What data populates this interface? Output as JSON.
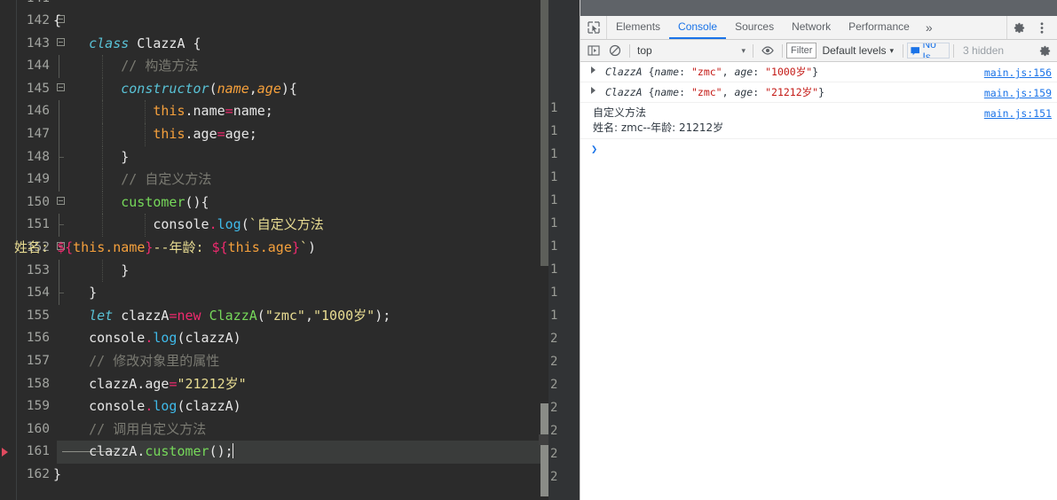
{
  "editor": {
    "first_visible_line": 141,
    "current_line": 161,
    "lines": [
      {
        "num": "141",
        "text": "",
        "clipped": true
      },
      {
        "num": "142",
        "text": "{"
      },
      {
        "num": "143",
        "text": "class ClazzA {"
      },
      {
        "num": "144",
        "text": "// 构造方法"
      },
      {
        "num": "145",
        "text": "constructor(name,age){"
      },
      {
        "num": "146",
        "text": "this.name=name;"
      },
      {
        "num": "147",
        "text": "this.age=age;"
      },
      {
        "num": "148",
        "text": "}"
      },
      {
        "num": "149",
        "text": "// 自定义方法"
      },
      {
        "num": "150",
        "text": "customer(){"
      },
      {
        "num": "151",
        "text": "console.log(`自定义方法"
      },
      {
        "num": "152",
        "text": "姓名: ${this.name}--年龄: ${this.age}`)"
      },
      {
        "num": "153",
        "text": "}"
      },
      {
        "num": "154",
        "text": "}"
      },
      {
        "num": "155",
        "text": "let clazzA=new ClazzA(\"zmc\",\"1000岁\");"
      },
      {
        "num": "156",
        "text": "console.log(clazzA)"
      },
      {
        "num": "157",
        "text": "// 修改对象里的属性"
      },
      {
        "num": "158",
        "text": "clazzA.age=\"21212岁\""
      },
      {
        "num": "159",
        "text": "console.log(clazzA)"
      },
      {
        "num": "160",
        "text": "// 调用自定义方法"
      },
      {
        "num": "161",
        "text": "clazzA.customer();"
      },
      {
        "num": "162",
        "text": "}"
      }
    ],
    "mini_gutter_numbers": [
      "1",
      "1",
      "1",
      "1",
      "1",
      "1",
      "1",
      "1",
      "1",
      "1",
      "2",
      "2",
      "2",
      "2",
      "2",
      "2",
      "2"
    ],
    "colors": {
      "background": "#2b2b2b",
      "keyword": "#59c2d6",
      "parameter": "#f5a03c",
      "operator": "#ef2a6e",
      "function": "#76d85a",
      "method": "#3fb9e8",
      "comment": "#7a7a72",
      "string": "#e8dc92",
      "plain": "#e6e6e6",
      "line_number": "#a2a4a0",
      "current_line_highlight": "#3a3c3b",
      "breakpoint_arrow": "#e04a5f"
    }
  },
  "devtools": {
    "tabs": [
      {
        "label": "Elements",
        "active": false
      },
      {
        "label": "Console",
        "active": true
      },
      {
        "label": "Sources",
        "active": false
      },
      {
        "label": "Network",
        "active": false
      },
      {
        "label": "Performance",
        "active": false
      }
    ],
    "more_tabs_label": "»",
    "inspect_icon": "inspect-element-icon",
    "device_toolbar_icon": "device-toolbar-icon",
    "settings_icon": "gear-icon",
    "menu_icon": "kebab-menu-icon",
    "console_toolbar": {
      "sidebar_toggle_icon": "console-sidebar-icon",
      "clear_icon": "clear-console-icon",
      "context_selector": "top",
      "context_arrow": "▾",
      "eye_icon": "live-expression-icon",
      "filter_placeholder": "Filter",
      "levels_label": "Default levels",
      "levels_arrow": "▾",
      "issues_label": "No Is",
      "issues_icon": "issues-message-icon",
      "hidden_label": "3 hidden",
      "settings_icon": "console-settings-gear-icon"
    },
    "messages": [
      {
        "type": "object",
        "expandable": true,
        "class_name": "ClazzA",
        "props": [
          {
            "key": "name",
            "value": "\"zmc\""
          },
          {
            "key": "age",
            "value": "\"1000岁\""
          }
        ],
        "source": "main.js:156"
      },
      {
        "type": "object",
        "expandable": true,
        "class_name": "ClazzA",
        "props": [
          {
            "key": "name",
            "value": "\"zmc\""
          },
          {
            "key": "age",
            "value": "\"21212岁\""
          }
        ],
        "source": "main.js:159"
      },
      {
        "type": "text",
        "expandable": false,
        "lines": [
          "自定义方法",
          "姓名: zmc--年龄: 21212岁"
        ],
        "source": "main.js:151"
      }
    ],
    "prompt_caret": "❯",
    "colors": {
      "accent": "#1a73e8",
      "toolbar_bg": "#f3f3f3",
      "console_bg": "#ffffff",
      "string_value": "#c41a16",
      "text": "#303942",
      "muted": "#9aa0a6"
    }
  }
}
